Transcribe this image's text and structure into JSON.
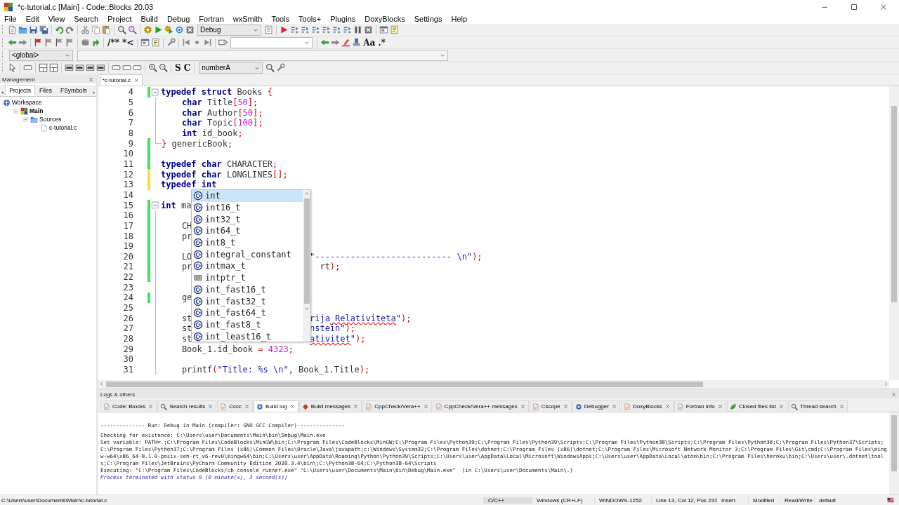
{
  "window": {
    "title": "*c-tutorial.c [Main] - Code::Blocks 20.03"
  },
  "menu": [
    "File",
    "Edit",
    "View",
    "Search",
    "Project",
    "Build",
    "Debug",
    "Fortran",
    "wxSmith",
    "Tools",
    "Tools+",
    "Plugins",
    "DoxyBlocks",
    "Settings",
    "Help"
  ],
  "toolbars": [
    [
      {
        "kind": "page"
      },
      {
        "kind": "folder"
      },
      {
        "kind": "disk"
      },
      {
        "kind": "disks"
      },
      {
        "kind": "sep"
      },
      {
        "kind": "undo"
      },
      {
        "kind": "redo"
      },
      {
        "kind": "sep"
      },
      {
        "kind": "cut"
      },
      {
        "kind": "copy"
      },
      {
        "kind": "paste"
      },
      {
        "kind": "sep"
      },
      {
        "kind": "find"
      },
      {
        "kind": "findrepl"
      },
      {
        "kind": "sep"
      },
      {
        "kind": "gear"
      },
      {
        "kind": "play"
      },
      {
        "kind": "gearplay"
      },
      {
        "kind": "cycle"
      },
      {
        "kind": "xbox"
      },
      {
        "kind": "combo",
        "value": "Debug"
      },
      {
        "kind": "doclist"
      },
      {
        "kind": "sep"
      },
      {
        "kind": "redplay"
      },
      {
        "kind": "step"
      },
      {
        "kind": "step"
      },
      {
        "kind": "step"
      },
      {
        "kind": "step"
      },
      {
        "kind": "step"
      },
      {
        "kind": "step"
      },
      {
        "kind": "pause"
      },
      {
        "kind": "xbox"
      },
      {
        "kind": "sep"
      },
      {
        "kind": "window"
      },
      {
        "kind": "note"
      }
    ],
    [
      {
        "kind": "back"
      },
      {
        "kind": "fwd"
      },
      {
        "kind": "sep"
      },
      {
        "kind": "redflag"
      },
      {
        "kind": "flag"
      },
      {
        "kind": "flag"
      },
      {
        "kind": "flag"
      },
      {
        "kind": "sep"
      },
      {
        "kind": "stack"
      },
      {
        "kind": "jump"
      },
      {
        "kind": "sep"
      },
      {
        "kind": "text",
        "label": "/**"
      },
      {
        "kind": "text",
        "label": "*<"
      },
      {
        "kind": "sep"
      },
      {
        "kind": "window"
      },
      {
        "kind": "note"
      },
      {
        "kind": "sep"
      },
      {
        "kind": "wrench"
      },
      {
        "kind": "sep"
      },
      {
        "kind": "barleft"
      },
      {
        "kind": "dot"
      },
      {
        "kind": "barright"
      },
      {
        "kind": "sep"
      },
      {
        "kind": "tag"
      },
      {
        "kind": "combo"
      },
      {
        "kind": "sep"
      },
      {
        "kind": "back"
      },
      {
        "kind": "fwd"
      },
      {
        "kind": "marker"
      },
      {
        "kind": "stamp"
      },
      {
        "kind": "text",
        "label": "Aa"
      },
      {
        "kind": "text",
        "label": ".*"
      }
    ],
    [
      {
        "kind": "combo",
        "value": "<global>"
      },
      {
        "kind": "combo-wide"
      }
    ],
    [
      {
        "kind": "pointer"
      },
      {
        "kind": "sep"
      },
      {
        "kind": "rect"
      },
      {
        "kind": "sep"
      },
      {
        "kind": "frame"
      },
      {
        "kind": "frame"
      },
      {
        "kind": "sep"
      },
      {
        "kind": "panel"
      },
      {
        "kind": "panel"
      },
      {
        "kind": "panel"
      },
      {
        "kind": "panel"
      },
      {
        "kind": "sep"
      },
      {
        "kind": "rect"
      },
      {
        "kind": "rect"
      },
      {
        "kind": "rect"
      },
      {
        "kind": "sep"
      },
      {
        "kind": "zoomin"
      },
      {
        "kind": "zoomout"
      },
      {
        "kind": "sep"
      },
      {
        "kind": "text",
        "label": "S"
      },
      {
        "kind": "text",
        "label": "C"
      },
      {
        "kind": "sep"
      },
      {
        "kind": "combo",
        "value": "numberA"
      },
      {
        "kind": "find"
      },
      {
        "kind": "wrench"
      }
    ]
  ],
  "management": {
    "title": "Management",
    "tabs": [
      {
        "label": "Projects",
        "selected": true
      },
      {
        "label": "Files",
        "selected": false
      },
      {
        "label": "FSymbols",
        "selected": false
      }
    ],
    "tree": [
      {
        "label": "Workspace",
        "kind": "workspace",
        "active": false,
        "children": [
          {
            "label": "Main",
            "kind": "project",
            "active": true,
            "expanded": true,
            "children": [
              {
                "label": "Sources",
                "kind": "srcfolder",
                "active": false,
                "expanded": true,
                "children": [
                  {
                    "label": "c-tutorial.c",
                    "kind": "file",
                    "active": false
                  }
                ]
              }
            ]
          }
        ]
      }
    ]
  },
  "editor": {
    "tabs": [
      {
        "label": "*c-tutorial.c",
        "selected": true
      }
    ],
    "lines": [
      {
        "number": "4",
        "color": "#40e060",
        "fold_start": true,
        "fold_end": false,
        "code": [
          {
            "kind": "kw",
            "text": "typedef"
          },
          {
            "kind": "kw",
            "text": " struct"
          },
          {
            "kind": "id",
            "text": " Books "
          },
          {
            "kind": "op",
            "text": "{"
          }
        ]
      },
      {
        "number": "5",
        "fold_start": false,
        "fold_end": false,
        "code": [
          {
            "kind": "kw",
            "text": "    char"
          },
          {
            "kind": "id",
            "text": " Title"
          },
          {
            "kind": "op",
            "text": "["
          },
          {
            "kind": "num",
            "text": "50"
          },
          {
            "kind": "op",
            "text": "];"
          }
        ]
      },
      {
        "number": "6",
        "fold_start": false,
        "fold_end": false,
        "code": [
          {
            "kind": "kw",
            "text": "    char"
          },
          {
            "kind": "id",
            "text": " Author"
          },
          {
            "kind": "op",
            "text": "["
          },
          {
            "kind": "num",
            "text": "50"
          },
          {
            "kind": "op",
            "text": "];"
          }
        ]
      },
      {
        "number": "7",
        "fold_start": false,
        "fold_end": false,
        "code": [
          {
            "kind": "kw",
            "text": "    char"
          },
          {
            "kind": "id",
            "text": " Topic"
          },
          {
            "kind": "op",
            "text": "["
          },
          {
            "kind": "num",
            "text": "100"
          },
          {
            "kind": "op",
            "text": "];"
          }
        ]
      },
      {
        "number": "8",
        "fold_start": false,
        "fold_end": false,
        "code": [
          {
            "kind": "kw",
            "text": "    int"
          },
          {
            "kind": "id",
            "text": " id_book"
          },
          {
            "kind": "op",
            "text": ";"
          }
        ]
      },
      {
        "number": "9",
        "color": "#40e060",
        "fold_start": false,
        "fold_end": true,
        "code": [
          {
            "kind": "op",
            "text": "}"
          },
          {
            "kind": "id",
            "text": " genericBook"
          },
          {
            "kind": "op",
            "text": ";"
          }
        ]
      },
      {
        "number": "10",
        "color": "#40e060",
        "fold_start": false,
        "fold_end": false
      },
      {
        "number": "11",
        "color": "#40e060",
        "fold_start": false,
        "fold_end": false,
        "code": [
          {
            "kind": "kw",
            "text": "typedef"
          },
          {
            "kind": "kw",
            "text": " char"
          },
          {
            "kind": "id",
            "text": " CHARACTER"
          },
          {
            "kind": "op",
            "text": ";"
          }
        ]
      },
      {
        "number": "12",
        "color": "#f0e040",
        "fold_start": false,
        "fold_end": false,
        "code": [
          {
            "kind": "kw",
            "text": "typedef"
          },
          {
            "kind": "kw",
            "text": " char"
          },
          {
            "kind": "id",
            "text": " LONGLINES"
          },
          {
            "kind": "op",
            "text": "[];"
          }
        ]
      },
      {
        "number": "13",
        "color": "#f0e040",
        "fold_start": false,
        "fold_end": false,
        "code": [
          {
            "kind": "kw",
            "text": "typedef"
          },
          {
            "kind": "kw",
            "text": " int"
          }
        ]
      },
      {
        "number": "14",
        "fold_start": false,
        "fold_end": false
      },
      {
        "number": "15",
        "color": "#40e060",
        "fold_start": true,
        "fold_end": false,
        "code": [
          {
            "kind": "kw",
            "text": "int"
          },
          {
            "kind": "id",
            "text": " ma"
          }
        ]
      },
      {
        "number": "16",
        "color": "#40e060",
        "fold_start": false,
        "fold_end": false
      },
      {
        "number": "17",
        "color": "#40e060",
        "fold_start": false,
        "fold_end": false,
        "code": [
          {
            "kind": "id",
            "text": "    CH"
          }
        ]
      },
      {
        "number": "18",
        "color": "#40e060",
        "fold_start": false,
        "fold_end": false,
        "code": [
          {
            "kind": "id",
            "text": "    pr"
          }
        ]
      },
      {
        "number": "19",
        "color": "#40e060",
        "fold_start": false,
        "fold_end": false
      },
      {
        "number": "20",
        "color": "#40e060",
        "fold_start": false,
        "fold_end": false,
        "code": [
          {
            "kind": "id",
            "text": "    LO"
          }
        ],
        "tail": [
          {
            "kind": "str",
            "text": "\"--------------------------- \\n\""
          },
          {
            "kind": "op",
            "text": ");"
          }
        ]
      },
      {
        "number": "21",
        "color": "#40e060",
        "fold_start": false,
        "fold_end": false,
        "code": [
          {
            "kind": "id",
            "text": "    pr"
          }
        ],
        "tail": [
          {
            "kind": "id",
            "text": "  rt"
          },
          {
            "kind": "op",
            "text": ");"
          }
        ]
      },
      {
        "number": "22",
        "color": "#40e060",
        "fold_start": false,
        "fold_end": false
      },
      {
        "number": "23",
        "fold_start": false,
        "fold_end": false
      },
      {
        "number": "24",
        "color": "#40e060",
        "fold_start": false,
        "fold_end": false,
        "code": [
          {
            "kind": "id",
            "text": "    ge"
          }
        ]
      },
      {
        "number": "25",
        "fold_start": false,
        "fold_end": false
      },
      {
        "number": "26",
        "fold_start": false,
        "fold_end": false,
        "code": [
          {
            "kind": "id",
            "text": "    st"
          }
        ],
        "tail": [
          {
            "kind": "str",
            "text": "rija"
          },
          {
            "kind": "spell",
            "text": " Relativiteta"
          },
          {
            "kind": "str",
            "text": "\""
          },
          {
            "kind": "op",
            "text": ");"
          }
        ]
      },
      {
        "number": "27",
        "fold_start": false,
        "fold_end": false,
        "code": [
          {
            "kind": "id",
            "text": "    st"
          }
        ],
        "tail": [
          {
            "kind": "str",
            "text": "nstein\""
          },
          {
            "kind": "op",
            "text": ");"
          }
        ]
      },
      {
        "number": "28",
        "fold_start": false,
        "fold_end": false,
        "code": [
          {
            "kind": "id",
            "text": "    st"
          }
        ],
        "tail": [
          {
            "kind": "spell",
            "text": "ativitet"
          },
          {
            "kind": "str",
            "text": "\""
          },
          {
            "kind": "op",
            "text": ");"
          }
        ]
      },
      {
        "number": "29",
        "fold_start": false,
        "fold_end": false,
        "code": [
          {
            "kind": "id",
            "text": "    Book_1.id_book"
          },
          {
            "kind": "op",
            "text": " ="
          },
          {
            "kind": "num",
            "text": " 4323"
          },
          {
            "kind": "op",
            "text": ";"
          }
        ]
      },
      {
        "number": "30",
        "fold_start": false,
        "fold_end": false
      },
      {
        "number": "31",
        "fold_start": false,
        "fold_end": false,
        "code": [
          {
            "kind": "id",
            "text": "    printf"
          },
          {
            "kind": "op",
            "text": "("
          },
          {
            "kind": "str",
            "text": "\"Title: %s \\n\""
          },
          {
            "kind": "op",
            "text": ","
          },
          {
            "kind": "id",
            "text": " Book_1.Title"
          },
          {
            "kind": "op",
            "text": ");"
          }
        ]
      }
    ],
    "completion": {
      "items": [
        {
          "label": "int",
          "kind": "class",
          "selected": true
        },
        {
          "label": "int16_t",
          "kind": "class",
          "selected": false
        },
        {
          "label": "int32_t",
          "kind": "class",
          "selected": false
        },
        {
          "label": "int64_t",
          "kind": "class",
          "selected": false
        },
        {
          "label": "int8_t",
          "kind": "class",
          "selected": false
        },
        {
          "label": "integral_constant",
          "kind": "class",
          "selected": false
        },
        {
          "label": "intmax_t",
          "kind": "class",
          "selected": false
        },
        {
          "label": "intptr_t",
          "kind": "typedef",
          "selected": false
        },
        {
          "label": "int_fast16_t",
          "kind": "class",
          "selected": false
        },
        {
          "label": "int_fast32_t",
          "kind": "class",
          "selected": false
        },
        {
          "label": "int_fast64_t",
          "kind": "class",
          "selected": false
        },
        {
          "label": "int_fast8_t",
          "kind": "class",
          "selected": false
        },
        {
          "label": "int_least16_t",
          "kind": "class",
          "selected": false
        }
      ]
    }
  },
  "logs": {
    "title": "Logs & others",
    "tabs": [
      {
        "label": "Code::Blocks",
        "kind": "page",
        "selected": false
      },
      {
        "label": "Search results",
        "kind": "find",
        "selected": false
      },
      {
        "label": "Cccc",
        "kind": "page",
        "selected": false
      },
      {
        "label": "Build log",
        "kind": "gearblue",
        "selected": true
      },
      {
        "label": "Build messages",
        "kind": "diamond",
        "selected": false
      },
      {
        "label": "CppCheck/Vera++",
        "kind": "page",
        "selected": false
      },
      {
        "label": "CppCheck/Vera++ messages",
        "kind": "page",
        "selected": false
      },
      {
        "label": "Cscope",
        "kind": "page",
        "selected": false
      },
      {
        "label": "Debugger",
        "kind": "gearblue",
        "selected": false
      },
      {
        "label": "DoxyBlocks",
        "kind": "page",
        "selected": false
      },
      {
        "label": "Fortran info",
        "kind": "page",
        "selected": false
      },
      {
        "label": "Closed files list",
        "kind": "leaf",
        "selected": false
      },
      {
        "label": "Thread search",
        "kind": "find",
        "selected": false
      }
    ],
    "lines": [
      {
        "kind": "plain",
        "text": "-------------- Run: Debug in Main (compiler: GNU GCC Compiler)---------------"
      },
      {
        "kind": "gap"
      },
      {
        "kind": "plain",
        "text": "Checking for existence: C:\\Users\\user\\Documents\\Main\\bin\\Debug\\Main.exe"
      },
      {
        "kind": "plain",
        "text": "Set variable: PATH=.;C:\\Program Files\\CodeBlocks\\MinGW\\bin;C:\\Program Files\\CodeBlocks\\MinGW;C:\\Program Files\\Python39;C:\\Program Files\\Python39\\Scripts;C:\\Program Files\\Python38\\Scripts;C:\\Program Files\\Python38;C:\\Program Files\\Python37\\Scripts;C:\\Program Files\\Python37;C:\\Program Files (x86)\\Common Files\\Oracle\\Java\\javapath;c:\\Windows\\System32;C:\\Program Files\\dotnet;C:\\Program Files (x86)\\dotnet;C:\\Program Files\\Microsoft Network Monitor 3;C:\\Program Files\\Git\\cmd;C:\\Program Files\\mingw-w64\\x86_64-8.1.0-posix-seh-rt_v6-rev0\\mingw64\\bin;C:\\Users\\user\\AppData\\Roaming\\Python\\Python39\\Scripts;C:\\Users\\user\\AppData\\Local\\Microsoft\\WindowsApps;C:\\Users\\user\\AppData\\Local\\atom\\bin;C:\\Program Files\\heroku\\bin;C:\\Users\\user\\.dotnet\\tools;C:\\Program Files\\JetBrains\\PyCharm Community Edition 2020.3.4\\bin\\;C:\\Python38-64;C:\\Python38-64\\Scripts"
      },
      {
        "kind": "plain",
        "text": "Executing: \"C:\\Program Files\\CodeBlocks/cb_console_runner.exe\" \"C:\\Users\\user\\Documents\\Main\\bin\\Debug\\Main.exe\"  (in C:\\Users\\user\\Documents\\Main\\.)"
      },
      {
        "kind": "process",
        "text": "Process terminated with status 0 (0 minute(s), 3 second(s))"
      }
    ]
  },
  "status_bar": {
    "path": "C:\\Users\\user\\Documents\\Main\\c-tutorial.c",
    "fields": [
      "C/C++",
      "Windows (CR+LF)",
      "WINDOWS-1252",
      "Line 13, Col 12, Pos 231",
      "Insert",
      "Modified",
      "Read/Write",
      "default"
    ]
  }
}
